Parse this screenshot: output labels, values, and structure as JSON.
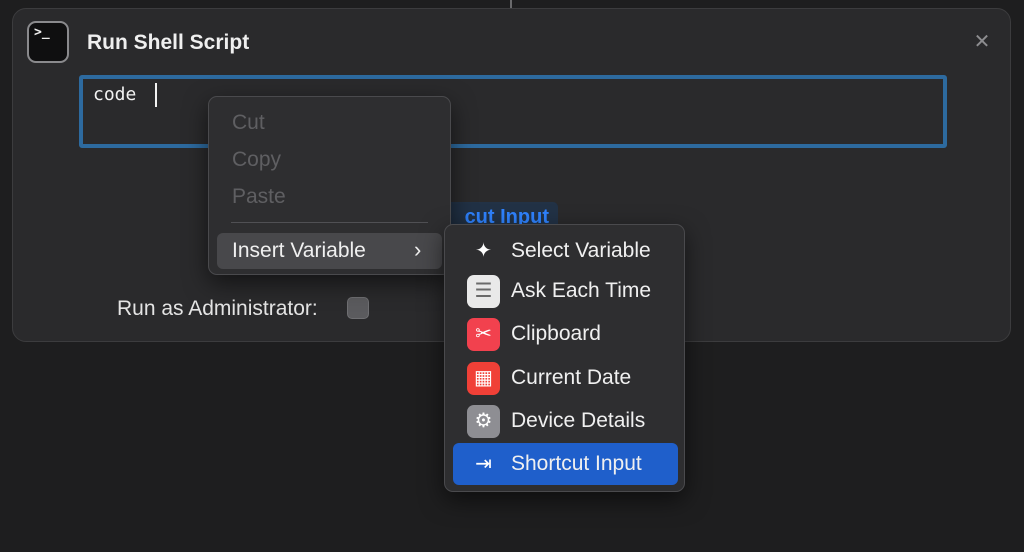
{
  "action": {
    "title": "Run Shell Script",
    "icon": "terminal-icon",
    "icon_glyph": ">_",
    "close_glyph": "✕",
    "script_value": "code ",
    "input_token_label": "Shortcut Input",
    "input_token_partial": "cut Input",
    "admin_label": "Run as Administrator:",
    "admin_checked": false
  },
  "context_menu": {
    "items": [
      {
        "label": "Cut",
        "enabled": false
      },
      {
        "label": "Copy",
        "enabled": false
      },
      {
        "label": "Paste",
        "enabled": false
      }
    ],
    "insert_variable": {
      "label": "Insert Variable",
      "chevron": "›"
    }
  },
  "submenu": {
    "items": [
      {
        "label": "Select Variable",
        "icon": "magic-wand-icon",
        "icon_glyph": "✦",
        "icon_color": "transparent"
      },
      {
        "label": "Ask Each Time",
        "icon": "speech-bubble-icon",
        "icon_glyph": "☰",
        "icon_color": "#e9e9e9"
      },
      {
        "label": "Clipboard",
        "icon": "scissors-icon",
        "icon_glyph": "✂",
        "icon_color": "#f2414e"
      },
      {
        "label": "Current Date",
        "icon": "calendar-icon",
        "icon_glyph": "▦",
        "icon_color": "#f04037"
      },
      {
        "label": "Device Details",
        "icon": "gear-icon",
        "icon_glyph": "⚙",
        "icon_color": "#8e8e93"
      },
      {
        "label": "Shortcut Input",
        "icon": "input-arrow-icon",
        "icon_glyph": "⇥",
        "icon_color": "transparent",
        "selected": true
      }
    ]
  },
  "colors": {
    "accent": "#2d6a9f",
    "selection": "#1f5fcb",
    "token_text": "#2f83ff"
  }
}
